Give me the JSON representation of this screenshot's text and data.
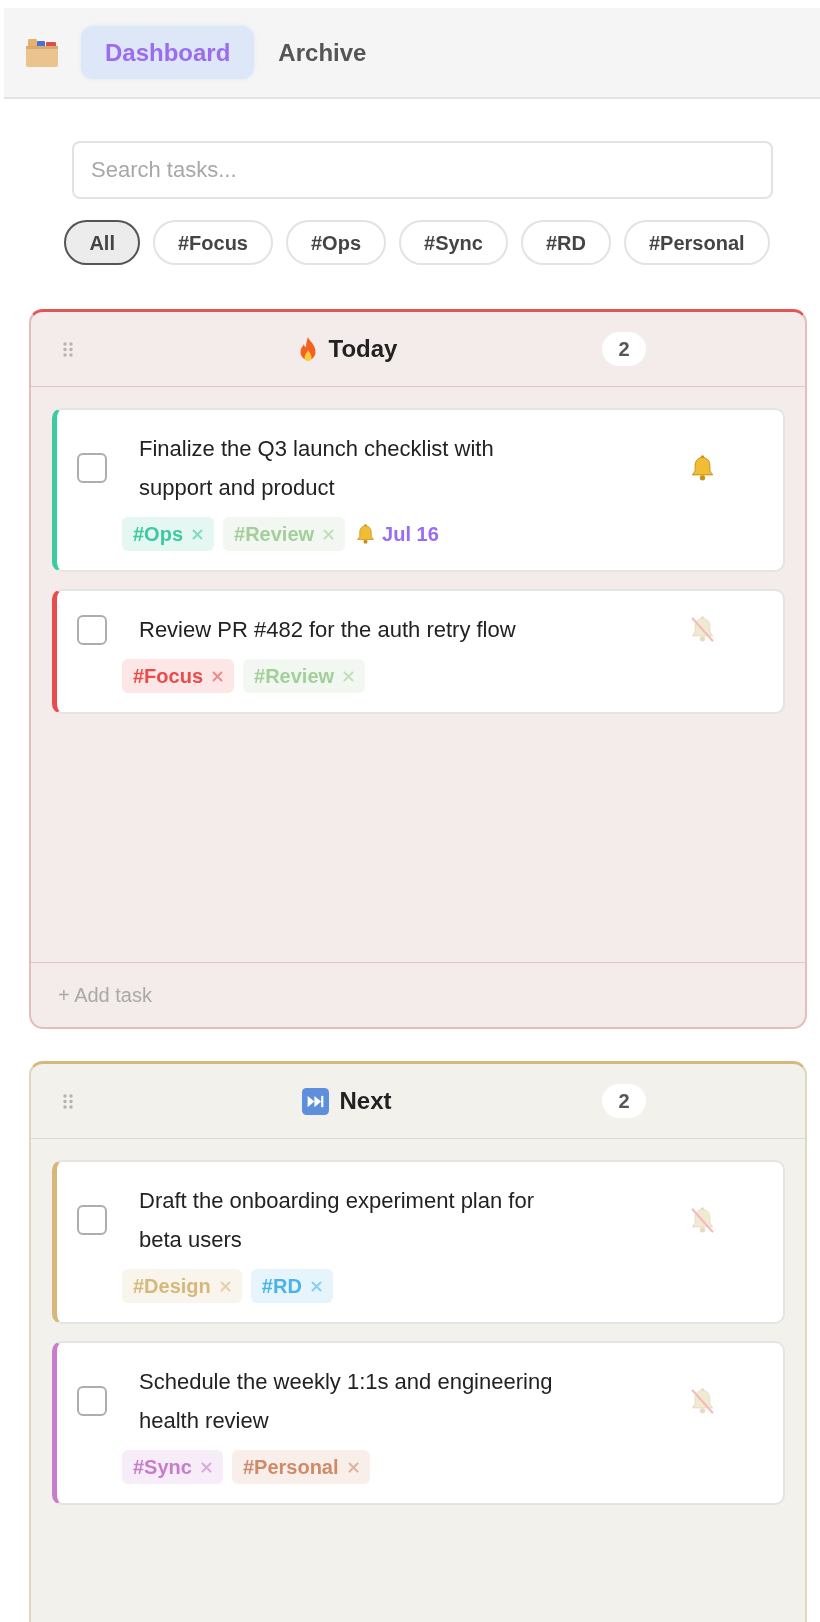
{
  "nav": {
    "tabs": [
      {
        "label": "Dashboard",
        "selected": true
      },
      {
        "label": "Archive",
        "selected": false
      }
    ]
  },
  "search": {
    "placeholder": "Search tasks..."
  },
  "filters": [
    {
      "label": "All",
      "selected": true
    },
    {
      "label": "#Focus",
      "selected": false
    },
    {
      "label": "#Ops",
      "selected": false
    },
    {
      "label": "#Sync",
      "selected": false
    },
    {
      "label": "#RD",
      "selected": false
    },
    {
      "label": "#Personal",
      "selected": false
    }
  ],
  "columns": [
    {
      "kind": "today",
      "title": "Today",
      "count": "2",
      "color": "#e25555",
      "tasks": [
        {
          "title": "Finalize the Q3 launch checklist with support and product",
          "checked": false,
          "color": "#3ec9a0",
          "reminder": true,
          "tags": [
            {
              "label": "#Ops",
              "color": "#3ec9a0"
            },
            {
              "label": "#Review",
              "color": "#a3cf9a"
            }
          ],
          "due": "Jul 16"
        },
        {
          "title": "Review PR #482 for the auth retry flow",
          "checked": false,
          "color": "#e84c4c",
          "reminder": false,
          "tags": [
            {
              "label": "#Focus",
              "color": "#e84c4c"
            },
            {
              "label": "#Review",
              "color": "#a3cf9a"
            }
          ]
        }
      ],
      "add_label": "+ Add task"
    },
    {
      "kind": "next",
      "title": "Next",
      "count": "2",
      "color": "#d6b97a",
      "tasks": [
        {
          "title": "Draft the onboarding experiment plan for beta users",
          "checked": false,
          "color": "#d6b97a",
          "reminder": false,
          "tags": [
            {
              "label": "#Design",
              "color": "#d6b97a"
            },
            {
              "label": "#RD",
              "color": "#4ab4ea"
            }
          ]
        },
        {
          "title": "Schedule the weekly 1:1s and engineering health review",
          "checked": false,
          "color": "#c77dcc",
          "reminder": false,
          "tags": [
            {
              "label": "#Sync",
              "color": "#c77dcc"
            },
            {
              "label": "#Personal",
              "color": "#d08a68"
            }
          ]
        }
      ]
    }
  ]
}
